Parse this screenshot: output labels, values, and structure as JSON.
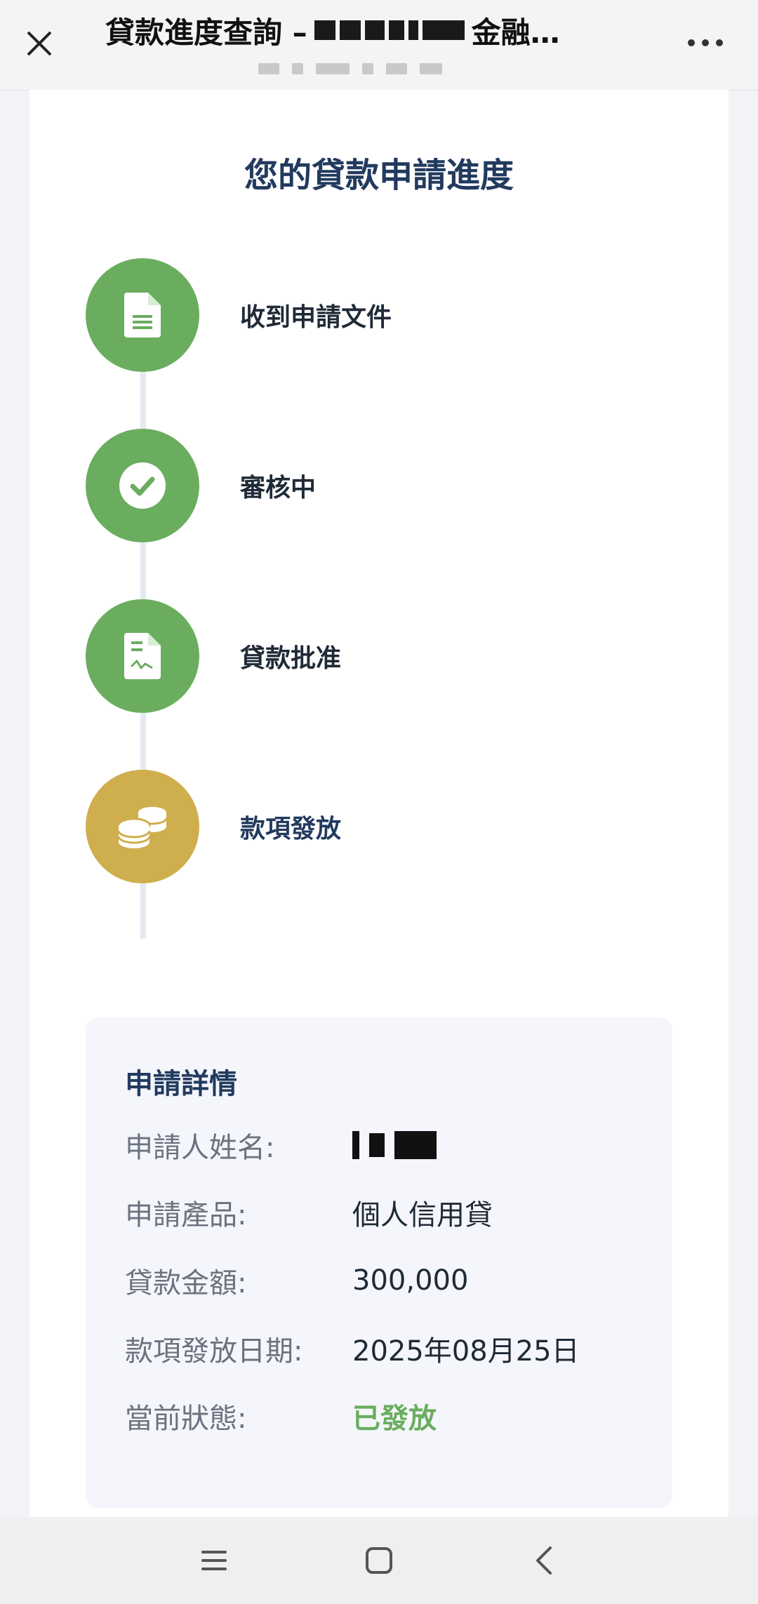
{
  "topbar": {
    "title_prefix": "貸款進度查詢 –",
    "title_suffix": "金融…"
  },
  "page": {
    "heading": "您的貸款申請進度"
  },
  "steps": [
    {
      "label": "收到申請文件",
      "icon": "document-icon",
      "status": "done",
      "color": "#6aad5f"
    },
    {
      "label": "審核中",
      "icon": "check-circle-icon",
      "status": "done",
      "color": "#6aad5f"
    },
    {
      "label": "貸款批准",
      "icon": "approved-document-icon",
      "status": "done",
      "color": "#6aad5f"
    },
    {
      "label": "款項發放",
      "icon": "coins-icon",
      "status": "current",
      "color": "#cfae4e"
    }
  ],
  "details": {
    "title": "申請詳情",
    "rows": [
      {
        "label": "申請人姓名:",
        "value": ""
      },
      {
        "label": "申請產品:",
        "value": "個人信用貸"
      },
      {
        "label": "貸款金額:",
        "value": "300,000"
      },
      {
        "label": "款項發放日期:",
        "value": "2025年08月25日"
      },
      {
        "label": "當前狀態:",
        "value": "已發放"
      }
    ]
  },
  "colors": {
    "accent_navy": "#223a5e",
    "success_green": "#6aad5f",
    "gold": "#cfae4e"
  },
  "navbar": {
    "icons": [
      "menu-icon",
      "home-square-icon",
      "back-chevron-icon"
    ]
  }
}
